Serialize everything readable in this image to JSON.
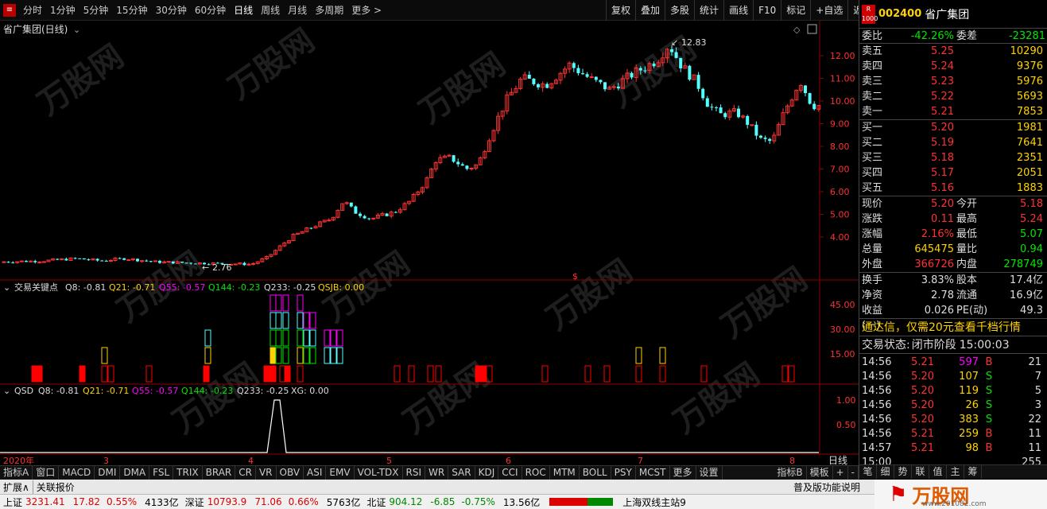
{
  "toolbar": {
    "periods": [
      "分时",
      "1分钟",
      "5分钟",
      "15分钟",
      "30分钟",
      "60分钟",
      "日线",
      "周线",
      "月线",
      "多周期",
      "更多 >"
    ],
    "active_period": "日线",
    "right_buttons": [
      "复权",
      "叠加",
      "多股",
      "统计",
      "画线",
      "F10",
      "标记",
      "+自选",
      "返回"
    ]
  },
  "chart": {
    "title": "省广集团(日线)",
    "high_label": "12.83",
    "low_label": "2.76",
    "y_ticks": [
      "12.00",
      "11.00",
      "10.00",
      "9.00",
      "8.00",
      "7.00",
      "6.00",
      "5.00",
      "4.00"
    ],
    "x_labels": [
      "2020年",
      "3",
      "4",
      "5",
      "6",
      "7",
      "8"
    ],
    "period_label": "日线"
  },
  "indicator1": {
    "name": "交易关键点",
    "q8": "Q8: -0.81",
    "q21": "Q21: -0.71",
    "q55": "Q55: -0.57",
    "q144": "Q144: -0.23",
    "q233": "Q233: -0.25",
    "qsjb": "QSJB: 0.00",
    "y_ticks": [
      "45.00",
      "30.00",
      "15.00"
    ]
  },
  "indicator2": {
    "name": "QSD",
    "q8": "Q8: -0.81",
    "q21": "Q21: -0.71",
    "q55": "Q55: -0.57",
    "q144": "Q144: -0.23",
    "q233": "Q233: -0.25",
    "xg": "XG: 0.00",
    "y_ticks": [
      "1.00",
      "0.50"
    ]
  },
  "bottom_tabs": [
    "指标A",
    "窗口",
    "MACD",
    "DMI",
    "DMA",
    "FSL",
    "TRIX",
    "BRAR",
    "CR",
    "VR",
    "OBV",
    "ASI",
    "EMV",
    "VOL-TDX",
    "RSI",
    "WR",
    "SAR",
    "KDJ",
    "CCI",
    "ROC",
    "MTM",
    "BOLL",
    "PSY",
    "MCST",
    "更多",
    "设置"
  ],
  "bottom_right_tabs": [
    "指标B",
    "模板",
    "+",
    "-"
  ],
  "stock": {
    "badge": "R 1000",
    "code": "002400",
    "name": "省广集团",
    "weibi_label": "委比",
    "weibi": "-42.26%",
    "weicha_label": "委差",
    "weicha": "-23281",
    "sells": [
      {
        "label": "卖五",
        "price": "5.25",
        "vol": "10290"
      },
      {
        "label": "卖四",
        "price": "5.24",
        "vol": "9376"
      },
      {
        "label": "卖三",
        "price": "5.23",
        "vol": "5976"
      },
      {
        "label": "卖二",
        "price": "5.22",
        "vol": "5693"
      },
      {
        "label": "卖一",
        "price": "5.21",
        "vol": "7853"
      }
    ],
    "buys": [
      {
        "label": "买一",
        "price": "5.20",
        "vol": "1981"
      },
      {
        "label": "买二",
        "price": "5.19",
        "vol": "7641"
      },
      {
        "label": "买三",
        "price": "5.18",
        "vol": "2351"
      },
      {
        "label": "买四",
        "price": "5.17",
        "vol": "2051"
      },
      {
        "label": "买五",
        "price": "5.16",
        "vol": "1883"
      }
    ],
    "stats": [
      {
        "l1": "现价",
        "v1": "5.20",
        "l2": "今开",
        "v2": "5.18"
      },
      {
        "l1": "涨跌",
        "v1": "0.11",
        "l2": "最高",
        "v2": "5.24"
      },
      {
        "l1": "涨幅",
        "v1": "2.16%",
        "l2": "最低",
        "v2": "5.07"
      },
      {
        "l1": "总量",
        "v1": "645475",
        "l2": "量比",
        "v2": "0.94"
      },
      {
        "l1": "外盘",
        "v1": "366726",
        "l2": "内盘",
        "v2": "278749"
      }
    ],
    "stats2": [
      {
        "l1": "换手",
        "v1": "3.83%",
        "l2": "股本",
        "v2": "17.4亿"
      },
      {
        "l1": "净资",
        "v1": "2.78",
        "l2": "流通",
        "v2": "16.9亿"
      },
      {
        "l1": "收益(一)",
        "v1": "0.026",
        "l2": "PE(动)",
        "v2": "49.3"
      }
    ],
    "ad_text": "通达信，仅需20元查看千档行情",
    "status_label": "交易状态:",
    "status": "闭市阶段",
    "status_time": "15:00:03",
    "ticks": [
      {
        "t": "14:56",
        "p": "5.21",
        "v": "597",
        "d": "B",
        "n": "21"
      },
      {
        "t": "14:56",
        "p": "5.20",
        "v": "107",
        "d": "S",
        "n": "7"
      },
      {
        "t": "14:56",
        "p": "5.20",
        "v": "119",
        "d": "S",
        "n": "5"
      },
      {
        "t": "14:56",
        "p": "5.20",
        "v": "26",
        "d": "S",
        "n": "3"
      },
      {
        "t": "14:56",
        "p": "5.20",
        "v": "383",
        "d": "S",
        "n": "22"
      },
      {
        "t": "14:56",
        "p": "5.21",
        "v": "259",
        "d": "B",
        "n": "11"
      },
      {
        "t": "14:57",
        "p": "5.21",
        "v": "98",
        "d": "B",
        "n": "11"
      },
      {
        "t": "15:00",
        "p": "",
        "v": "",
        "d": "",
        "n": "255"
      }
    ],
    "side_tabs": [
      "笔",
      "细",
      "势",
      "联",
      "值",
      "主",
      "筹"
    ]
  },
  "footer": {
    "expand": "扩展∧",
    "related": "关联报价",
    "right_link": "普及版功能说明",
    "sh_label": "上证",
    "sh_val": "3231.41",
    "sh_chg": "17.82",
    "sh_pct": "0.55%",
    "sh_amt": "4133亿",
    "sz_label": "深证",
    "sz_val": "10793.9",
    "sz_chg": "71.06",
    "sz_pct": "0.66%",
    "sz_amt": "5763亿",
    "bz_label": "北证",
    "bz_val": "904.12",
    "bz_chg": "-6.85",
    "bz_pct": "-0.75%",
    "bz_amt": "13.56亿",
    "server": "上海双线主站9"
  },
  "watermark": {
    "brand": "万股网",
    "url": "www.201082.com"
  },
  "colors": {
    "up": "#ff3232",
    "down": "#54ffff",
    "text": "#dddddd",
    "yellow": "#ffd200",
    "green": "#00e600"
  }
}
